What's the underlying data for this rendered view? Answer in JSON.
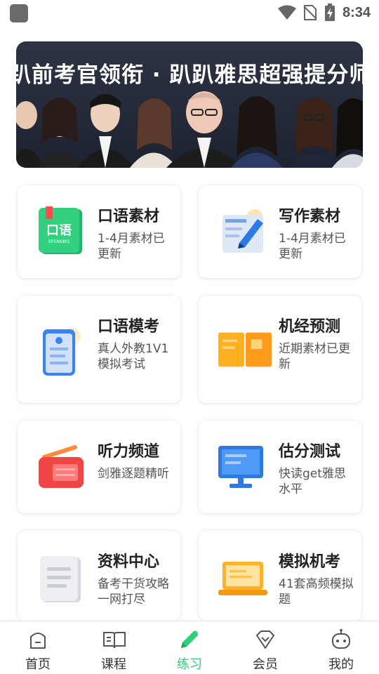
{
  "status_bar": {
    "time": "8:34",
    "icons": [
      "app-icon",
      "wifi-icon",
      "no-sim-icon",
      "battery-charging-icon"
    ]
  },
  "banner": {
    "title": "趴前考官领衔 · 趴趴雅思超强提分师资团"
  },
  "cards": [
    {
      "title": "口语素材",
      "desc": "1-4月素材已更新",
      "icon": "speaking-book-icon"
    },
    {
      "title": "写作素材",
      "desc": "1-4月素材已更新",
      "icon": "writing-pen-icon"
    },
    {
      "title": "口语模考",
      "desc": "真人外教1V1模拟考试",
      "icon": "phone-mock-icon"
    },
    {
      "title": "机经预测",
      "desc": "近期素材已更新",
      "icon": "forecast-book-icon"
    },
    {
      "title": "听力频道",
      "desc": "剑雅逐题精听",
      "icon": "radio-icon"
    },
    {
      "title": "估分测试",
      "desc": "快读get雅思水平",
      "icon": "monitor-icon"
    },
    {
      "title": "资料中心",
      "desc": "备考干货攻略一网打尽",
      "icon": "document-icon"
    },
    {
      "title": "模拟机考",
      "desc": "41套高频模拟题",
      "icon": "laptop-icon"
    }
  ],
  "icon_text": {
    "speaking_label": "口语",
    "speaking_sub": "SPEAKING"
  },
  "nav": [
    {
      "label": "首页",
      "icon": "home-icon",
      "active": false
    },
    {
      "label": "课程",
      "icon": "course-book-icon",
      "active": false
    },
    {
      "label": "练习",
      "icon": "practice-pen-icon",
      "active": true
    },
    {
      "label": "会员",
      "icon": "vip-diamond-icon",
      "active": false
    },
    {
      "label": "我的",
      "icon": "profile-robot-icon",
      "active": false
    }
  ],
  "colors": {
    "accent": "#2fcf7a",
    "banner_bg": "#222838"
  }
}
